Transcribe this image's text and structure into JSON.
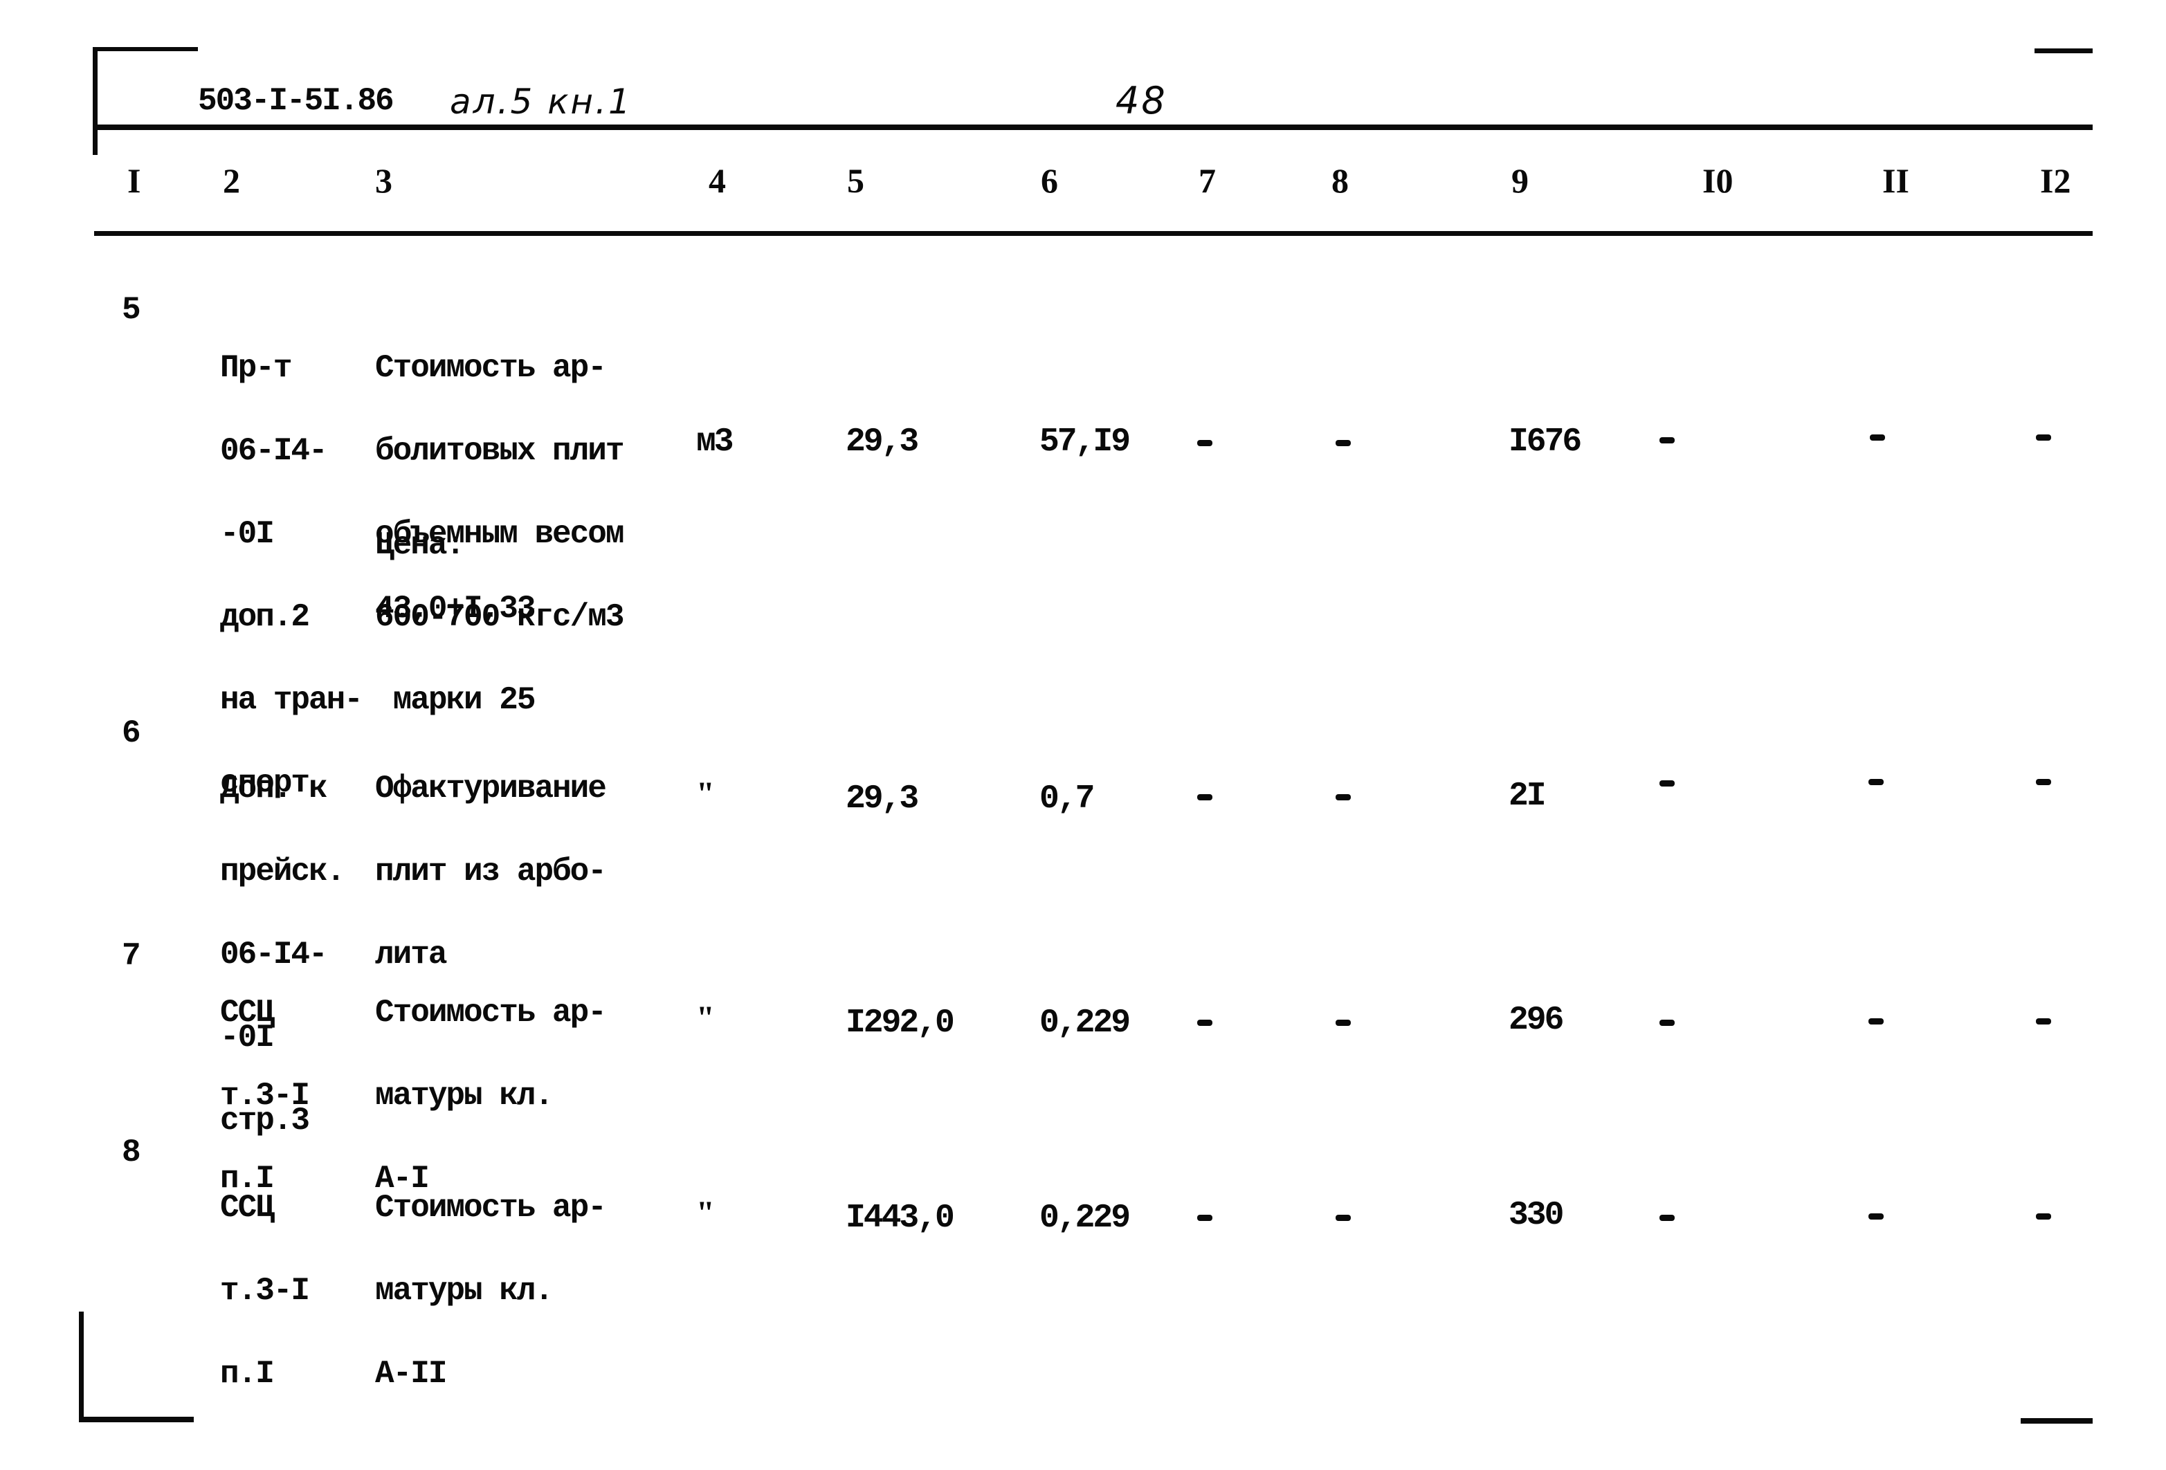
{
  "header": {
    "document_code": "503-I-5I.86",
    "document_ref_handwritten": "ал.5 кн.1",
    "page_number": "48"
  },
  "columns": [
    "I",
    "2",
    "3",
    "4",
    "5",
    "6",
    "7",
    "8",
    "9",
    "I0",
    "II",
    "I2"
  ],
  "rows": [
    {
      "no": "5",
      "basis": [
        "Пр-т",
        "06-I4-",
        "-0I",
        "доп.2",
        "на тран-",
        "спорт"
      ],
      "description": [
        "Стоимость ар-",
        "болитовых плит",
        "объемным весом",
        "600-700 кгс/м3",
        "марки 25"
      ],
      "price_label": "Цена:",
      "price_formula": "43,0+I,33",
      "unit": "м3",
      "quantity": "29,3",
      "unit_cost": "57,I9",
      "col7": "-",
      "col8": "-",
      "total": "I676",
      "col10": "-",
      "col11": "-",
      "col12": "-"
    },
    {
      "no": "6",
      "basis": [
        "Доп. к",
        "прейск.",
        "06-I4-",
        "-0I",
        "стр.3"
      ],
      "description": [
        "Офактуривание",
        "плит из арбо-",
        "лита"
      ],
      "unit": "\"",
      "quantity": "29,3",
      "unit_cost": "0,7",
      "col7": "-",
      "col8": "-",
      "total": "2I",
      "col10": "-",
      "col11": "-",
      "col12": "-"
    },
    {
      "no": "7",
      "basis": [
        "ССЦ",
        "т.3-I",
        "п.I"
      ],
      "description": [
        "Стоимость ар-",
        "матуры кл.",
        "А-I"
      ],
      "unit": "\"",
      "quantity": "I292,0",
      "unit_cost": "0,229",
      "col7": "-",
      "col8": "-",
      "total": "296",
      "col10": "-",
      "col11": "-",
      "col12": "-"
    },
    {
      "no": "8",
      "basis": [
        "ССЦ",
        "т.3-I",
        "п.I"
      ],
      "description": [
        "Стоимость ар-",
        "матуры кл.",
        "А-II"
      ],
      "unit": "\"",
      "quantity": "I443,0",
      "unit_cost": "0,229",
      "col7": "-",
      "col8": "-",
      "total": "330",
      "col10": "-",
      "col11": "-",
      "col12": "-"
    }
  ]
}
